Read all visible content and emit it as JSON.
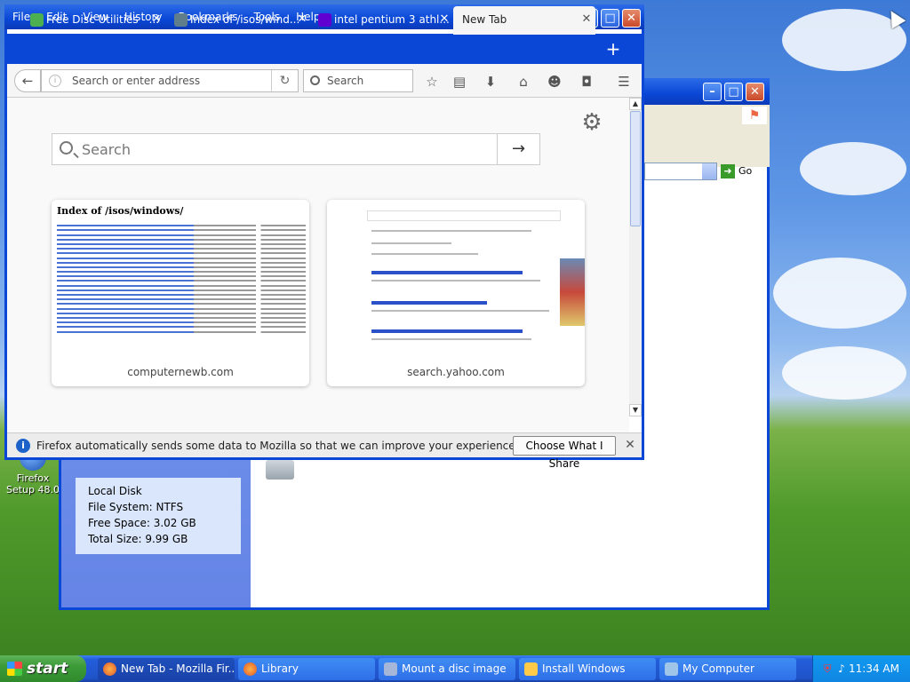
{
  "desktop": {
    "icon_label": "Firefox Setup 48.0"
  },
  "explorer": {
    "details": {
      "drive_type": "Local Disk",
      "file_system": "File System: NTFS",
      "free_space": "Free Space: 3.02 GB",
      "total_size": "Total Size: 9.99 GB"
    },
    "go_label": "Go"
  },
  "firefox": {
    "menu": [
      "File",
      "Edit",
      "View",
      "History",
      "Bookmarks",
      "Tools",
      "Help"
    ],
    "tabs": [
      {
        "label": "Free Disc Utilities - ...",
        "color": "#4caf50"
      },
      {
        "label": "Index of /isos/wind...",
        "color": "#607d8b"
      },
      {
        "label": "intel pentium 3 athl...",
        "color": "#6001d2"
      },
      {
        "label": "New Tab",
        "color": "#f5f5f5"
      }
    ],
    "url_placeholder": "Search or enter address",
    "search_placeholder": "Search",
    "newtab": {
      "search_placeholder": "Search",
      "tiles": [
        {
          "thumb_title": "Index of /isos/windows/",
          "site": "computernewb.com"
        },
        {
          "site": "search.yahoo.com"
        }
      ]
    },
    "notification": {
      "message": "Firefox automatically sends some data to Mozilla so that we can improve your experience.",
      "button": "Choose What I Share"
    }
  },
  "taskbar": {
    "start_label": "start",
    "items": [
      {
        "label": "New Tab - Mozilla Fir...",
        "icon": "firefox-icon",
        "active": true
      },
      {
        "label": "Library",
        "icon": "firefox-icon",
        "active": false
      },
      {
        "label": "Mount a disc image",
        "icon": "app-icon",
        "active": false
      },
      {
        "label": "Install Windows",
        "icon": "app-icon",
        "active": false
      },
      {
        "label": "My Computer",
        "icon": "computer-icon",
        "active": false
      }
    ],
    "clock": "11:34 AM"
  }
}
